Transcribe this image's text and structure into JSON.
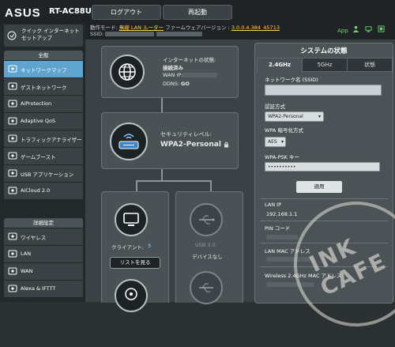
{
  "header": {
    "brand": "ASUS",
    "model": "RT-AC88U",
    "logout_label": "ログアウト",
    "reboot_label": "再起動",
    "mode_label": "動作モード:",
    "mode_value": "無線 LAN ルーター",
    "firmware_label": "ファームウェアバージョン :",
    "firmware_value": "3.0.0.4.384_45713",
    "ssid_label": "SSID:",
    "app_label": "App"
  },
  "sidebar": {
    "quick_setup": "クイック インターネット セットアップ",
    "general_header": "全般",
    "general_items": [
      {
        "label": "ネットワークマップ",
        "icon": "network-map-icon"
      },
      {
        "label": "ゲストネットワーク",
        "icon": "guest-network-icon"
      },
      {
        "label": "AiProtection",
        "icon": "aiprotection-icon"
      },
      {
        "label": "Adaptive QoS",
        "icon": "qos-icon"
      },
      {
        "label": "トラフィックアナライザー",
        "icon": "traffic-analyzer-icon"
      },
      {
        "label": "ゲームブースト",
        "icon": "game-boost-icon"
      },
      {
        "label": "USB アプリケーション",
        "icon": "usb-app-icon"
      },
      {
        "label": "AiCloud 2.0",
        "icon": "aicloud-icon"
      }
    ],
    "advanced_header": "詳細設定",
    "advanced_items": [
      {
        "label": "ワイヤレス",
        "icon": "wireless-icon"
      },
      {
        "label": "LAN",
        "icon": "lan-icon"
      },
      {
        "label": "WAN",
        "icon": "wan-icon"
      },
      {
        "label": "Alexa & IFTTT",
        "icon": "alexa-icon"
      }
    ]
  },
  "map": {
    "internet": {
      "status_label": "インターネットの状態:",
      "status_value": "接続済み",
      "wan_ip_label": "WAN IP:",
      "ddns_label": "DDNS:",
      "ddns_value": "GO"
    },
    "security": {
      "label": "セキュリティレベル:",
      "value": "WPA2-Personal"
    },
    "clients": {
      "label": "クライアント:",
      "count": "5",
      "button": "リストを見る"
    },
    "usb": {
      "label": "USB 3.0",
      "status": "デバイスなし"
    }
  },
  "status_panel": {
    "title": "システムの状態",
    "tabs": [
      "2.4GHz",
      "5GHz",
      "状態"
    ],
    "network_name_label": "ネットワーク名 (SSID)",
    "auth_label": "認証方式",
    "auth_value": "WPA2-Personal",
    "encryption_label": "WPA 暗号化方式",
    "encryption_value": "AES",
    "psk_label": "WPA-PSK キー",
    "psk_value": "••••••••••",
    "apply_label": "適用",
    "lan_ip_label": "LAN IP",
    "lan_ip_value": "192.168.1.1",
    "pin_label": "PIN コード",
    "lan_mac_label": "LAN MAC アドレス",
    "wireless_mac_label": "Wireless 2.4GHz MAC アドレス"
  },
  "watermark": "INK CAFE",
  "colors": {
    "active": "#5fa4cf",
    "yellow": "#ffd54a",
    "background": "#2b3033"
  }
}
